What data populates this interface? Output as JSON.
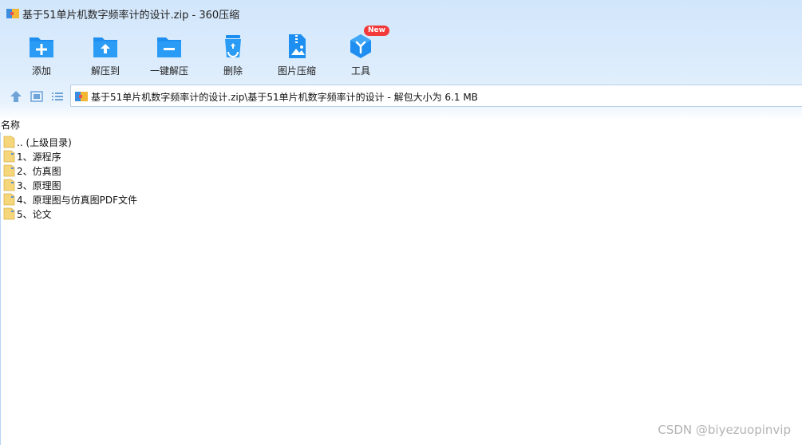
{
  "window": {
    "title": "基于51单片机数字频率计的设计.zip - 360压缩"
  },
  "toolbar": {
    "items": [
      {
        "label": "添加",
        "icon": "add-folder-icon"
      },
      {
        "label": "解压到",
        "icon": "extract-to-folder-icon"
      },
      {
        "label": "一键解压",
        "icon": "one-click-extract-icon"
      },
      {
        "label": "删除",
        "icon": "recycle-bin-icon"
      },
      {
        "label": "图片压缩",
        "icon": "image-compress-icon"
      },
      {
        "label": "工具",
        "icon": "tools-cube-icon",
        "badge": "New"
      }
    ]
  },
  "address": {
    "path": "基于51单片机数字频率计的设计.zip\\基于51单片机数字频率计的设计 - 解包大小为 6.1 MB"
  },
  "list": {
    "column_name": "名称",
    "items": [
      {
        "name": ".. (上级目录)"
      },
      {
        "name": "1、源程序"
      },
      {
        "name": "2、仿真图"
      },
      {
        "name": "3、原理图"
      },
      {
        "name": "4、原理图与仿真图PDF文件"
      },
      {
        "name": "5、论文"
      }
    ]
  },
  "watermark": "CSDN @biyezuopinvip",
  "colors": {
    "accent": "#1e8ff0",
    "folder": "#f6d67a",
    "badge": "#f23a3a"
  }
}
